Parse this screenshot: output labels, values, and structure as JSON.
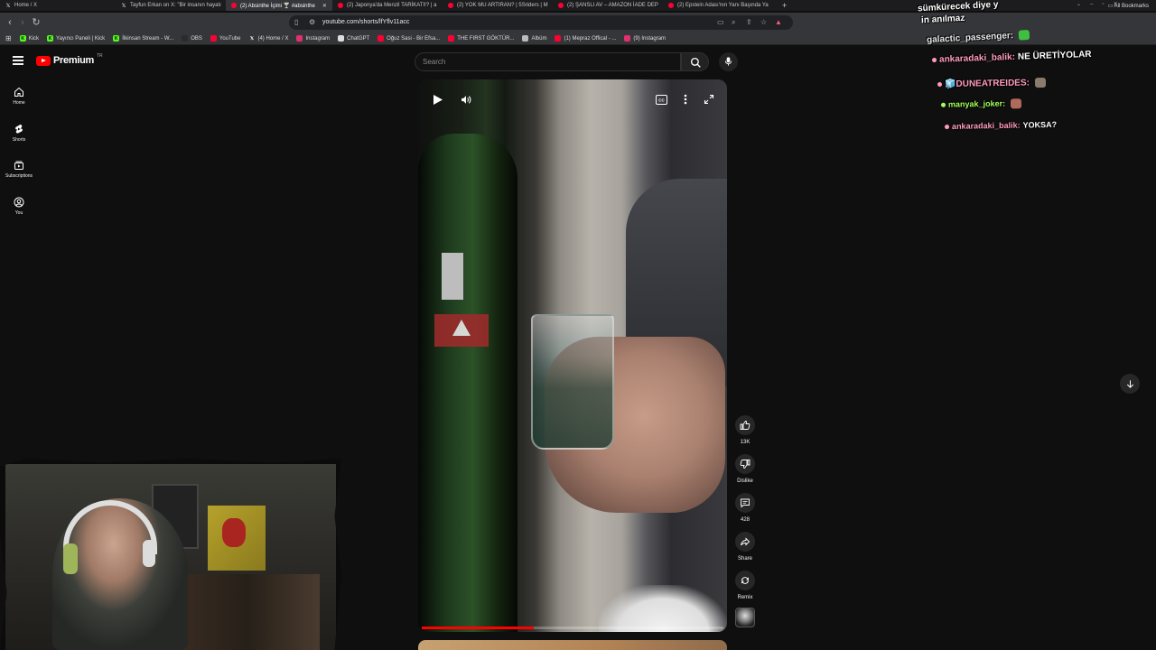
{
  "browser": {
    "tabs": [
      {
        "label": "Home / X",
        "icon": "x-logo-icon",
        "color": "#ffffff",
        "width": 128
      },
      {
        "label": "Tayfun Erkan on X: \"Bir insanın hayatı",
        "icon": "x-logo-icon",
        "color": "#ffffff",
        "width": 122
      },
      {
        "label": "(2) Absinthe İçimi 🍸 #absinthe",
        "icon": "youtube-icon",
        "color": "#ff0033",
        "width": 118,
        "active": true
      },
      {
        "label": "(2) Japonya'da Menzil TARİKATI!? | a",
        "icon": "youtube-icon",
        "color": "#ff0033",
        "width": 122
      },
      {
        "label": "(2) YOK MU ARTIRAN? | 5Sriders | M",
        "icon": "youtube-icon",
        "color": "#ff0033",
        "width": 122
      },
      {
        "label": "(2) ŞANSLI AV – AMAZON İADE DEP",
        "icon": "youtube-icon",
        "color": "#ff0033",
        "width": 122
      },
      {
        "label": "(2) Epstein Adası'nın Yanı Başında Ya",
        "icon": "youtube-icon",
        "color": "#ff0033",
        "width": 126
      }
    ],
    "url": "youtube.com/shorts/lfYflv11acc",
    "bookmarks": [
      {
        "label": "Kick",
        "icon": "kick-icon",
        "color": "#53fc18"
      },
      {
        "label": "Yayıncı Paneli | Kick",
        "icon": "kick-icon",
        "color": "#53fc18"
      },
      {
        "label": "İlkinsan Stream - W...",
        "icon": "kick-icon",
        "color": "#53fc18"
      },
      {
        "label": "OBS",
        "icon": "obs-icon",
        "color": "#2b2b2b"
      },
      {
        "label": "YouTube",
        "icon": "youtube-icon",
        "color": "#ff0033"
      },
      {
        "label": "(4) Home / X",
        "icon": "x-logo-icon",
        "color": "#ffffff"
      },
      {
        "label": "Instagram",
        "icon": "instagram-icon",
        "color": "#e1306c"
      },
      {
        "label": "ChatGPT",
        "icon": "chatgpt-icon",
        "color": "#dddddd"
      },
      {
        "label": "Oğuz Sasi - Bir Efsa...",
        "icon": "youtube-icon",
        "color": "#ff0033"
      },
      {
        "label": "THE FIRST GÖKTÜR...",
        "icon": "youtube-icon",
        "color": "#ff0033"
      },
      {
        "label": "Albüm",
        "icon": "folder-icon",
        "color": "#bbbbbb"
      },
      {
        "label": "(1) Mepraz Offical - ...",
        "icon": "youtube-icon",
        "color": "#ff0033"
      },
      {
        "label": "(9) Instagram",
        "icon": "instagram-icon",
        "color": "#e1306c"
      }
    ],
    "all_bookmarks": "All Bookmarks"
  },
  "youtube": {
    "brand": "Premium",
    "brand_suffix": "TR",
    "search_placeholder": "Search",
    "nav": [
      {
        "label": "Home",
        "icon": "home-icon"
      },
      {
        "label": "Shorts",
        "icon": "shorts-icon"
      },
      {
        "label": "Subscriptions",
        "icon": "subscriptions-icon"
      },
      {
        "label": "You",
        "icon": "user-icon"
      }
    ],
    "actions": [
      {
        "label": "13K",
        "icon": "thumbs-up-icon"
      },
      {
        "label": "Dislike",
        "icon": "thumbs-down-icon"
      },
      {
        "label": "428",
        "icon": "comment-icon"
      },
      {
        "label": "Share",
        "icon": "share-icon"
      },
      {
        "label": "Remix",
        "icon": "remix-icon"
      }
    ],
    "progress_fraction": 0.37,
    "accent": "#ff0000"
  },
  "chat": {
    "header_fragment": "sümkürecek diye y",
    "header_fragment2": "in anılmaz",
    "messages": [
      {
        "user": "galactic_passenger:",
        "text": "",
        "user_color": "#e7e7e7",
        "emote_color": "#3fbf3f"
      },
      {
        "user": "ankaradaki_balik:",
        "text": "NE ÜRETİYOLAR",
        "user_color": "#ff9bbd",
        "emote_color": ""
      },
      {
        "user": "🧊DUNEATREIDES:",
        "text": "",
        "user_color": "#ff9bbd",
        "emote_color": "#8a7b6e"
      },
      {
        "user": "manyak_joker:",
        "text": "",
        "user_color": "#a4ff5a",
        "emote_color": "#b0695a"
      },
      {
        "user": "ankaradaki_balik:",
        "text": "YOKSA?",
        "user_color": "#ff9bbd",
        "emote_color": ""
      }
    ]
  }
}
